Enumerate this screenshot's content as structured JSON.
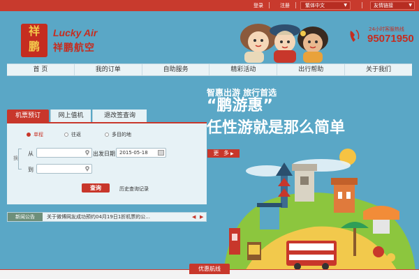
{
  "topbar": {
    "login": "登录",
    "register": "注册",
    "language": "繁体中文",
    "links": "友情链接"
  },
  "header": {
    "logo_text": "祥鹏",
    "brand_en": "Lucky Air",
    "brand_cn": "祥鹏航空",
    "hotline_label": "24小时客服热线",
    "hotline_number": "95071950"
  },
  "nav": {
    "items": [
      "首 页",
      "我的订单",
      "自助服务",
      "精彩活动",
      "出行帮助",
      "关于我们"
    ]
  },
  "booking": {
    "tabs": [
      "机票预订",
      "网上值机",
      "退改签查询"
    ],
    "trip_types": [
      "单程",
      "往返",
      "多目的地"
    ],
    "swap_label": "换",
    "from_label": "从",
    "to_label": "到",
    "from_value": "",
    "to_value": "",
    "date_label": "出发日期",
    "date_value": "2015-05-18",
    "search_button": "查询",
    "history_link": "历史查询记录"
  },
  "promo": {
    "line1": "智惠出游  旅行首选",
    "title": "“鹏游惠”",
    "subtitle": "任性游就是那么简单",
    "more_button": "更 多"
  },
  "news": {
    "label": "新闻公告",
    "text": "关于微博网友成功预约04月19日1折机票的公..."
  },
  "bottom": {
    "featured_routes": "优惠航线"
  },
  "colors": {
    "brand_red": "#c8372b",
    "page_blue": "#5aa7c6"
  }
}
